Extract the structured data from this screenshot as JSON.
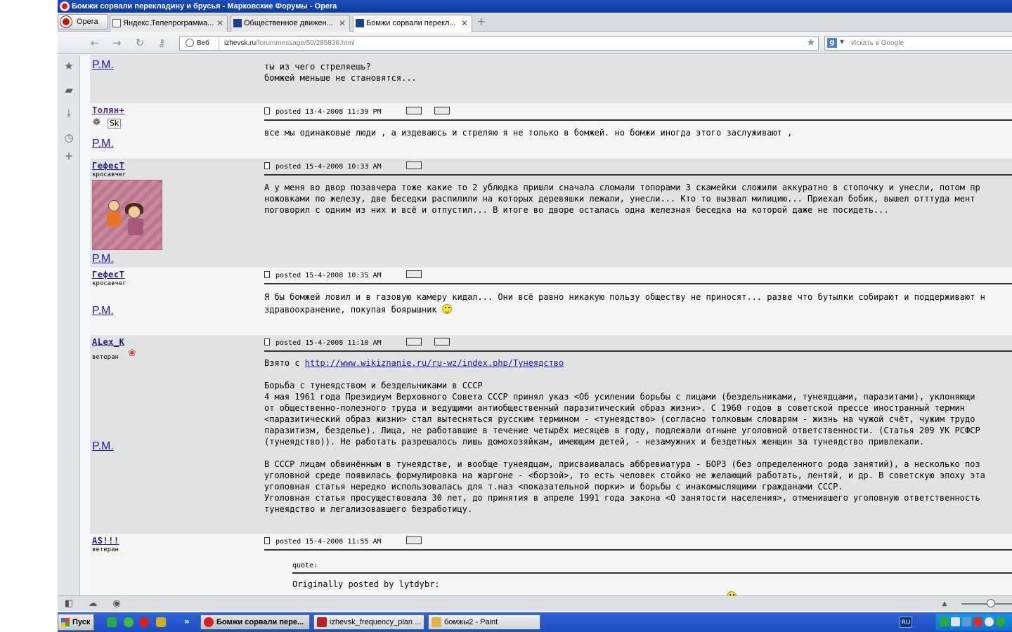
{
  "window": {
    "title": "Бомжи сорвали перекладину и брусья - Марковские Форумы - Opera",
    "opera_menu_label": "Opera"
  },
  "tabs": [
    {
      "label": "Яндекс.Телепрограмма..."
    },
    {
      "label": "Общественное движен..."
    },
    {
      "label": "Бомжи сорвали перекл..."
    }
  ],
  "nav": {
    "web_label": "Веб",
    "url_host": "izhevsk.ru",
    "url_path": "/forummessage/50/285836.html",
    "search_placeholder": "Искать в Google"
  },
  "posts": [
    {
      "pm_label": "P.M.",
      "lines": [
        "ты из чего стреляешь?",
        "бомжей меньше не становятся..."
      ]
    },
    {
      "author": "Толян+",
      "badge_text": "Sk",
      "posted": "posted 13-4-2008 11:39 PM",
      "pm_label": "P.M.",
      "lines": [
        "все мы одинаковые люди , а издеваюсь и стреляю я не только в бомжей. но бомжи иногда этого заслуживают ,"
      ]
    },
    {
      "author": "ГефесТ",
      "rank": "кросавчег",
      "posted": "posted 15-4-2008 10:33 AM",
      "pm_label": "P.M.",
      "lines": [
        "А у меня во двор позавчера тоже какие то 2 ублюдка пришли сначала сломали топорами 3 скамейки сложили аккуратно в стопочку и унесли, потом пр",
        "ножовками по железу, две беседки распилили на которых деревяшки лежали, унесли... Кто то вызвал милицию... Приехал бобик, вышел отттуда мент",
        "поговорил с одним из них и всё и отпустил... В итоге во дворе осталась одна железная беседка на которой даже не посидеть..."
      ]
    },
    {
      "author": "ГефесТ",
      "rank": "кросавчег",
      "posted": "posted 15-4-2008 10:35 AM",
      "pm_label": "P.M.",
      "lines": [
        "Я бы бомжей ловил и в газовую камеру кидал... Они всё равно никакую пользу обществу не приносят... разве что бутылки собирают и поддерживают н",
        "здравоохранение, покупая боярышник"
      ]
    },
    {
      "author": "ALex_K",
      "rank": "ветеран",
      "posted": "posted 15-4-2008 11:10 AM",
      "pm_label": "P.M.",
      "source_prefix": "Взято с ",
      "source_link": "http://www.wikiznanie.ru/ru-wz/index.php/Тунеядство",
      "lines": [
        "Борьба с тунеядством и бездельниками в СССР",
        "4 мая 1961 года Президиум Верховного Совета СССР принял указ <Об усилении борьбы с лицами (бездельниками, тунеядцами, паразитами), уклоняющи",
        "от общественно-полезного труда и ведущими антиобщественный паразитический образ жизни>. С 1960 годов в советской прессе иностранный термин",
        "<паразитический образ жизни> стал вытесняться русским термином - <тунеядство> (согласно толковым словарям - жизнь на чужой счёт, чужим трудо",
        "паразитизм, безделье). Лица, не работавшие в течение четырёх месяцев в году, подлежали отныне уголовной ответственности. (Статья 209 УК РСФСР",
        "(тунеядство)). Не работать разрешалось лишь домохозяйкам, имеющим детей, - незамужних и бездетных женщин за тунеядство привлекали.",
        "",
        "В СССР лицам обвинённым в тунеядстве, и вообще тунеядцам, присваивалась аббревиатура - БОРЗ (без определенного рода занятий), а несколько поз",
        "уголовной среде появилась формулировка на жаргоне - <борзой>, то есть человек стойко не желающий работать, лентяй, и др. В советскую эпоху эта",
        "уголовная статья нередко использовалась для т.наз <показательной порки> и борьбы с инакомыслящими гражданами СССР.",
        "Уголовная статья просуществовала 30 лет, до принятия в апреле 1991 года закона <О занятости населения>, отменившего уголовную ответственность",
        "тунеядство и легализовавшего безработицу."
      ]
    },
    {
      "author": "AS!!!",
      "rank": "ветеран",
      "posted": "posted 15-4-2008 11:55 AM",
      "quote_label": "quote:",
      "quote_by": "Originally posted by lytdybr:"
    }
  ],
  "taskbar": {
    "start_label": "Пуск",
    "windows": [
      {
        "label": "Бомжи сорвали пере..."
      },
      {
        "label": "izhevsk_frequency_plan ..."
      },
      {
        "label": "бомжы2 - Paint"
      }
    ],
    "lang": "RU",
    "overflow": "»"
  },
  "colors": {
    "titlebar": "#0b3a9e",
    "taskbar": "#1e4fc0",
    "link": "#1a1aa8",
    "post_dark_bg": "#e0e2e4",
    "post_light_bg": "#f5f5f5"
  }
}
